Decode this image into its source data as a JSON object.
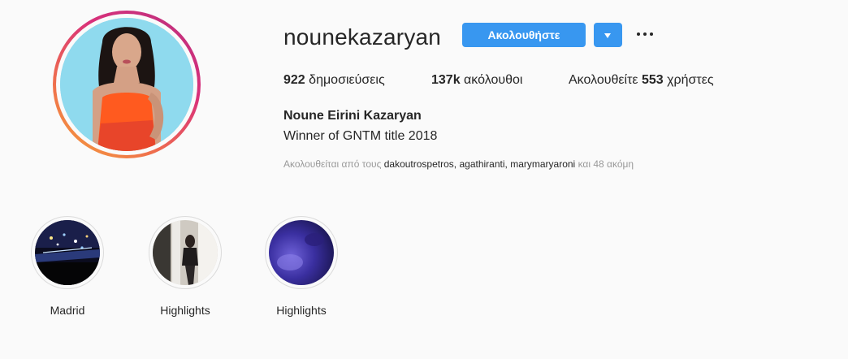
{
  "profile": {
    "username": "nounekazaryan",
    "follow_label": "Ακολουθήστε",
    "stats": {
      "posts_count": "922",
      "posts_label": "δημοσιεύσεις",
      "followers_count": "137k",
      "followers_label": "ακόλουθοι",
      "following_prefix": "Ακολουθείτε",
      "following_count": "553",
      "following_suffix": "χρήστες"
    },
    "full_name": "Noune Eirini Kazaryan",
    "bio": "Winner of GNTM title 2018",
    "followed_by": {
      "prefix": "Ακολουθείται από τους",
      "accounts": [
        "dakoutrospetros",
        "agathiranti",
        "marymaryaroni"
      ],
      "separator": ",",
      "suffix": "και 48 ακόμη"
    }
  },
  "icons": {
    "dropdown": "triangle-down-icon",
    "options": "ellipsis-icon"
  },
  "highlights": [
    {
      "label": "Madrid"
    },
    {
      "label": "Highlights"
    },
    {
      "label": "Highlights"
    }
  ],
  "colors": {
    "accent": "#3897f0",
    "text": "#262626",
    "muted": "#999999",
    "background": "#fafafa",
    "story_ring_start": "#f5a33a",
    "story_ring_end": "#b8307f"
  }
}
